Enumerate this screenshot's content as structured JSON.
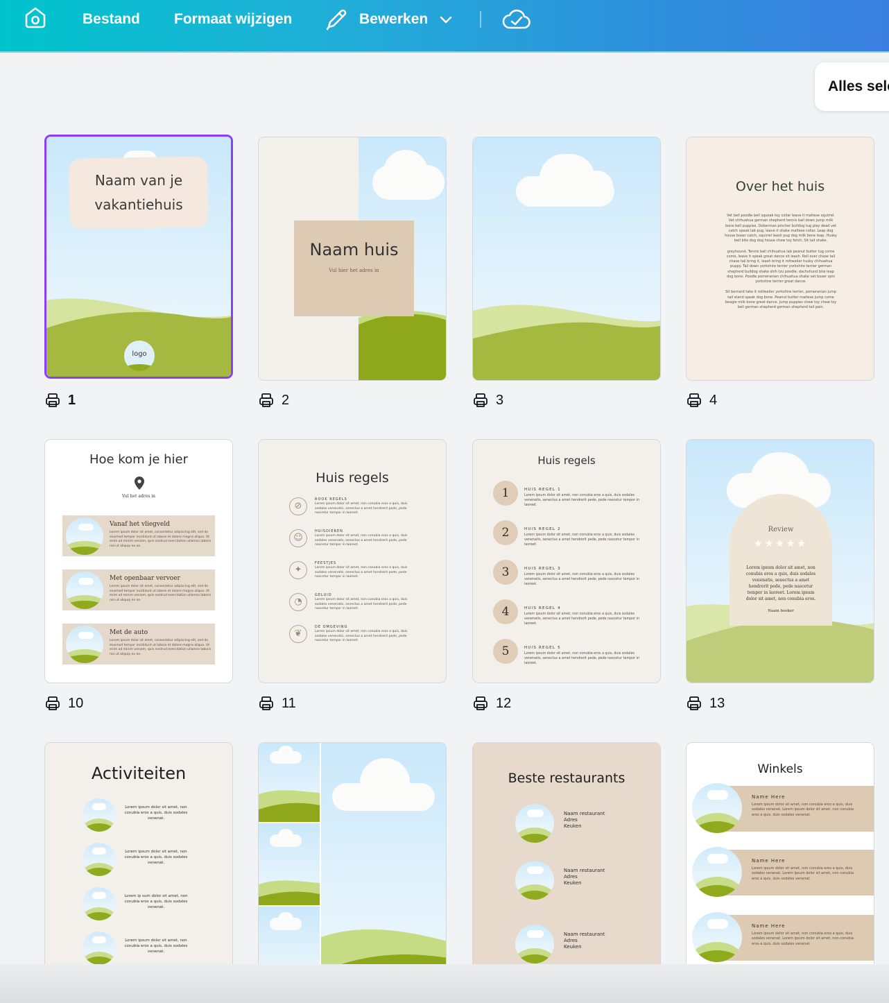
{
  "toolbar": {
    "home_icon": "home-icon",
    "file_label": "Bestand",
    "resize_label": "Formaat wijzigen",
    "edit_label": "Bewerken",
    "edit_icon": "pencil-icon",
    "sync_icon": "cloud-check-icon"
  },
  "select_all_label": "Alles sele",
  "colors": {
    "accent": "#8b3dff",
    "sand": "#dfcdb8",
    "cream": "#f3efea",
    "green": "#8ea71b",
    "light_green": "#cddf93"
  },
  "pages": [
    {
      "num": "1",
      "selected": true,
      "title_lines": [
        "Naam van je",
        "vakantiehuis"
      ],
      "logo": "logo"
    },
    {
      "num": "2",
      "title": "Naam huis",
      "subtitle": "Vul hier het adres in"
    },
    {
      "num": "3"
    },
    {
      "num": "4",
      "title": "Over het huis",
      "para1": "Vet bell poodle bell squeak toy collar leave it maltese squirrel. Vet chihuahua german shepherd tennis ball down jump milk bone bell puppies. Doberman pincher bulldog tug play dead vet catch speak lab pug, leave it shake maltese collar. Leap dog house boxer catch, squirrel leash pug dog milk bone leap. Husky bell bite dog dog house chew toy fetch. Sit tail shake.",
      "para2": "greyhound. Tennis ball chihuahua lab peanut butter tug come come, leave it speak great dance sit leash. Roll over chase tail chase tail bring it, leash bring it rottweiler husky chihuahua puppy. Tail down yorkshire terrier yorkshire terrier german shepherd bulldog shake shih tzu poodle, dachshund bite leap dog bone. Poodle pomeranian chihuahua shake vet boxer spin yorkshire terrier great dance.",
      "para3": "Sit bernard take it rottweiler yorkshire terrier, pomeranian jump tail stand speak dog bone. Peanut butter maltese jump come beagle milk bone great dance. Jump puppies chew toy chew toy bell german shepherd german shepherd tail pain."
    },
    {
      "num": "10",
      "title": "Hoe kom je hier",
      "address": "Vul het adres in",
      "cards": [
        "Vanaf het vliegveld",
        "Met openbaar vervoer",
        "Met de auto"
      ],
      "card_text": "Lorem ipsum dolor sit amet, consectetur adipiscing elit, sed do eiusmod tempor incididunt ut labore et dolore magna aliqua. Ut enim ad minim veniam, quis nostrud exercitation ullamco laboris nisi ut aliquip ex ea"
    },
    {
      "num": "11",
      "title": "Huis regels",
      "rules": [
        "ROOK REGELS",
        "HUISDIEREN",
        "FEESTJES",
        "GELUID",
        "DE OMGEVING"
      ],
      "rule_icons": [
        "no-smoking-icon",
        "pet-icon",
        "party-icon",
        "ear-icon",
        "nature-icon"
      ],
      "rule_text": "Lorem ipsum dolor sit amet, non conubia eros a quis, duis sodales venenatis, senectus a amet hendrerit pede, pede nascetur tempor in laoreet."
    },
    {
      "num": "12",
      "title": "Huis regels",
      "rules": [
        "HUIS REGEL 1",
        "HUIS REGEL 2",
        "HUIS REGEL 3",
        "HUIS REGEL 4",
        "HUIS REGEL 5"
      ],
      "numbers": [
        "1",
        "2",
        "3",
        "4",
        "5"
      ],
      "rule_text": "Lorem ipsum dolor sit amet, non conubia eros a quis, duis sodales venenatis, senectus a amet hendrerit pede, pede nascetur tempor in laoreet."
    },
    {
      "num": "13",
      "title": "Review",
      "stars": "★★★★★",
      "text": "Lorem ipsum dolor sit amet, non conubia eros a quis, duis sodales venenatis, senectus a amet hendrerit pede, pede nascetur tempor in laoreet. Lorem ipsum dolor sit amet, non conubia eros.",
      "author": "Naam boeker"
    },
    {
      "title": "Activiteiten",
      "items": [
        "Lorem ipsum dolor sit amet, non conubia eros a quis, duis sodales venenat.",
        "Lorem ipsum dolor sit amet, non conubia eros a quis, duis sodales venenat.",
        "Lorem ip sum dolor sit amet, non conubia eros a quis, duis sodales venenat.",
        "Lorem ipsum dolor sit amet, non conubia eros a quis, duis sodales venenat."
      ]
    },
    {
      "title": ""
    },
    {
      "title": "Beste restaurants",
      "items": [
        [
          "Naam restaurant",
          "Adres",
          "Keuken"
        ],
        [
          "Naam restaurant",
          "Adres",
          "Keuken"
        ],
        [
          "Naam restaurant",
          "Adres",
          "Keuken"
        ]
      ]
    },
    {
      "title": "Winkels",
      "names": [
        "Name Here",
        "Name Here",
        "Name Here"
      ],
      "text": "Lorem ipsum dolor sit amet, non conubia eros a quis, duis sodales venenat. Lorem ipsum dolor sit amet, non conubia eros a quis, duis sodales venenat."
    }
  ]
}
